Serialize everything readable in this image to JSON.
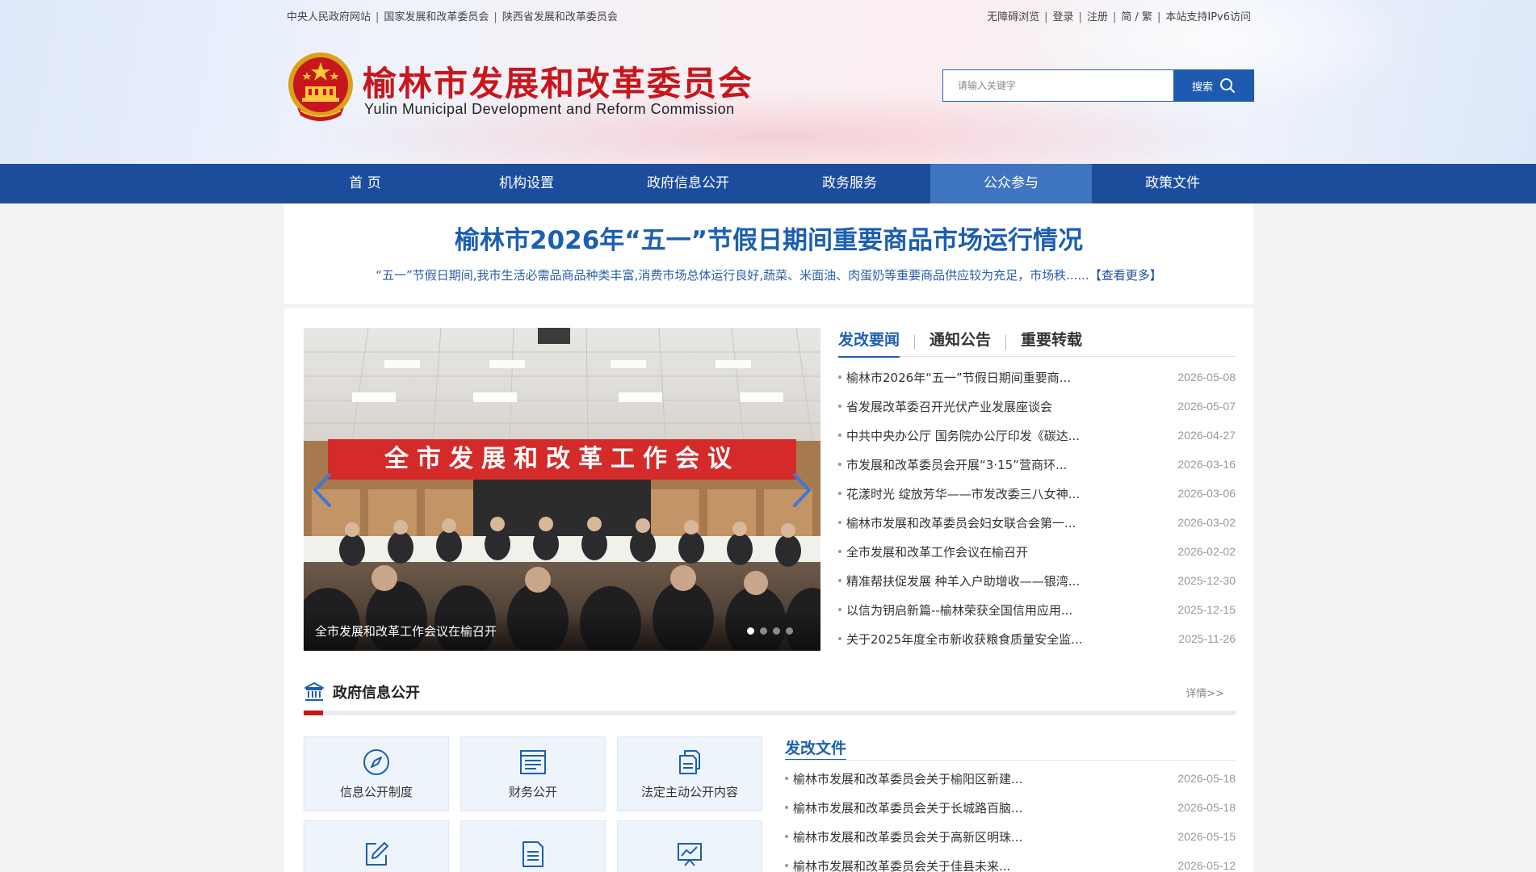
{
  "top_links_left": [
    "中央人民政府网站",
    "国家发展和改革委员会",
    "陕西省发展和改革委员会"
  ],
  "top_links_right": {
    "accessibility": "无障碍浏览",
    "login": "登录",
    "register": "注册",
    "simplified": "简",
    "traditional": "繁",
    "ipv6": "本站支持IPv6访问"
  },
  "site": {
    "title": "榆林市发展和改革委员会",
    "subtitle": "Yulin Municipal Development and Reform Commission"
  },
  "search": {
    "placeholder": "请输入关键字",
    "button_label": "搜索"
  },
  "nav": {
    "items": [
      "首 页",
      "机构设置",
      "政府信息公开",
      "政务服务",
      "公众参与",
      "政策文件"
    ],
    "active_index": 4
  },
  "headline": {
    "title": "榆林市2026年“五一”节假日期间重要商品市场运行情况",
    "summary": "“五一”节假日期间,我市生活必需品商品种类丰富,消费市场总体运行良好,蔬菜、米面油、肉蛋奶等重要商品供应较为充足，市场秩......",
    "more": "【查看更多】"
  },
  "carousel": {
    "banner_text": "全市发展和改革工作会议",
    "caption": "全市发展和改革工作会议在榆召开",
    "dot_count": 4,
    "active_dot": 0
  },
  "news": {
    "tabs": [
      "发改要闻",
      "通知公告",
      "重要转载"
    ],
    "active_tab": 0,
    "items": [
      {
        "title": "榆林市2026年“五一”节假日期间重要商...",
        "date": "2026-05-08"
      },
      {
        "title": "省发展改革委召开光伏产业发展座谈会",
        "date": "2026-05-07"
      },
      {
        "title": "中共中央办公厅 国务院办公厅印发《碳达...",
        "date": "2026-04-27"
      },
      {
        "title": "市发展和改革委员会开展“3·15”营商环...",
        "date": "2026-03-16"
      },
      {
        "title": "花漾时光 绽放芳华——市发改委三八女神...",
        "date": "2026-03-06"
      },
      {
        "title": "榆林市发展和改革委员会妇女联合会第一...",
        "date": "2026-03-02"
      },
      {
        "title": "全市发展和改革工作会议在榆召开",
        "date": "2026-02-02"
      },
      {
        "title": "精准帮扶促发展 种羊入户助增收——银湾...",
        "date": "2025-12-30"
      },
      {
        "title": "以信为钥启新篇--榆林荣获全国信用应用...",
        "date": "2025-12-15"
      },
      {
        "title": "关于2025年度全市新收获粮食质量安全监...",
        "date": "2025-11-26"
      }
    ]
  },
  "gov_info": {
    "title": "政府信息公开",
    "detail": "详情>>",
    "tiles": [
      {
        "label": "信息公开制度",
        "icon": "compass-icon"
      },
      {
        "label": "财务公开",
        "icon": "finance-list-icon"
      },
      {
        "label": "法定主动公开内容",
        "icon": "document-stack-icon"
      },
      {
        "label": "",
        "icon": "edit-icon"
      },
      {
        "label": "",
        "icon": "document-icon"
      },
      {
        "label": "",
        "icon": "chart-icon"
      }
    ]
  },
  "docs": {
    "title": "发改文件",
    "items": [
      {
        "title": "榆林市发展和改革委员会关于榆阳区新建...",
        "date": "2026-05-18"
      },
      {
        "title": "榆林市发展和改革委员会关于长城路百脑...",
        "date": "2026-05-18"
      },
      {
        "title": "榆林市发展和改革委员会关于高新区明珠...",
        "date": "2026-05-15"
      },
      {
        "title": "榆林市发展和改革委员会关于佳县未来...",
        "date": "2026-05-12"
      }
    ]
  },
  "colors": {
    "nav_bg": "#1c4d9c",
    "nav_active": "#3f74c0",
    "brand_red": "#c8161d",
    "link_blue": "#1c5fb1"
  }
}
